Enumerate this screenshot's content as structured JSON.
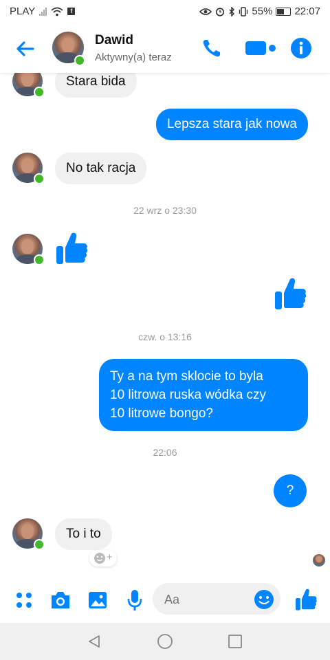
{
  "status_bar": {
    "carrier": "PLAY",
    "battery": "55%",
    "time": "22:07"
  },
  "header": {
    "contact_name": "Dawid",
    "contact_status": "Aktywny(a) teraz"
  },
  "messages": [
    {
      "side": "in",
      "text": "Stara bida"
    },
    {
      "side": "out",
      "text": "Lepsza stara jak nowa"
    },
    {
      "side": "in",
      "text": "No tak racja"
    },
    {
      "side": "in",
      "type": "like"
    },
    {
      "side": "out",
      "type": "like"
    },
    {
      "side": "out",
      "lines": [
        "Ty a na tym sklocie to byla",
        "10 litrowa ruska wódka czy",
        "10 litrowe bongo?"
      ]
    },
    {
      "side": "out",
      "text": "?"
    },
    {
      "side": "in",
      "text": "To i to"
    }
  ],
  "timestamps": [
    "22 wrz o 23:30",
    "czw. o 13:16",
    "22:06"
  ],
  "composer": {
    "placeholder": "Aa"
  },
  "colors": {
    "accent": "#0084ff",
    "incoming_bubble": "#f1f0f0",
    "online": "#42b72a"
  },
  "icons": [
    "back-arrow-icon",
    "phone-icon",
    "video-camera-icon",
    "info-icon",
    "apps-icon",
    "camera-icon",
    "gallery-icon",
    "microphone-icon",
    "emoji-icon",
    "thumbs-up-icon",
    "add-reaction-icon"
  ]
}
